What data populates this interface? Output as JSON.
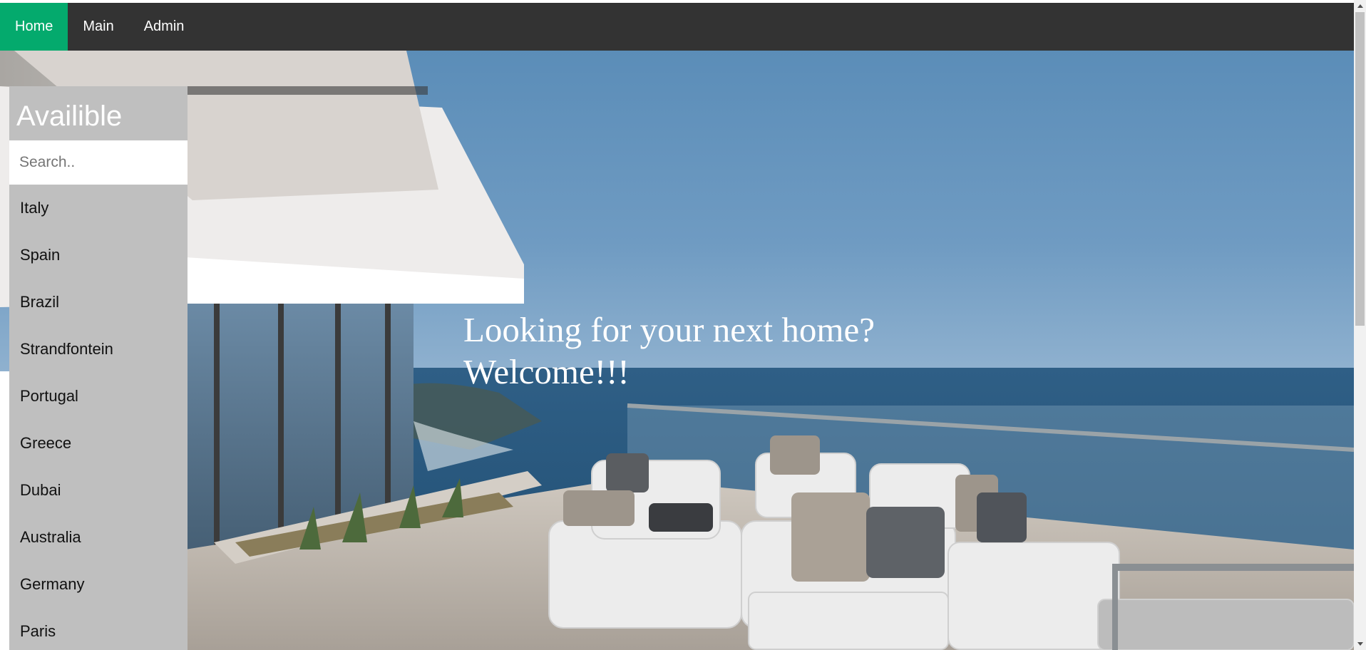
{
  "nav": {
    "items": [
      {
        "label": "Home",
        "active": true
      },
      {
        "label": "Main",
        "active": false
      },
      {
        "label": "Admin",
        "active": false
      }
    ],
    "active_color": "#04aa6d",
    "bar_color": "#333333"
  },
  "sidebar": {
    "title": "Availible",
    "search_placeholder": "Search..",
    "items": [
      "Italy",
      "Spain",
      "Brazil",
      "Strandfontein",
      "Portugal",
      "Greece",
      "Dubai",
      "Australia",
      "Germany",
      "Paris"
    ]
  },
  "hero": {
    "line1": "Looking for your next home?",
    "line2": "Welcome!!!",
    "image": "luxury-seaside-terrace-photo"
  },
  "icons": {
    "scroll_up": "chevron-up-icon",
    "scroll_down": "chevron-down-icon"
  }
}
